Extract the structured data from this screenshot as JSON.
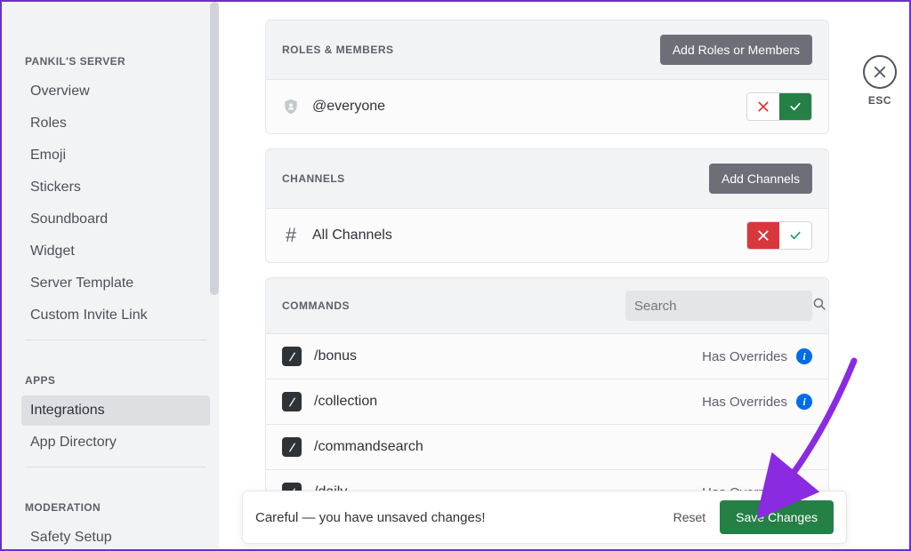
{
  "sidebar": {
    "server_title": "PANKIL'S SERVER",
    "items_main": [
      "Overview",
      "Roles",
      "Emoji",
      "Stickers",
      "Soundboard",
      "Widget",
      "Server Template",
      "Custom Invite Link"
    ],
    "apps_title": "APPS",
    "items_apps": [
      "Integrations",
      "App Directory"
    ],
    "mod_title": "MODERATION",
    "items_mod": [
      "Safety Setup"
    ],
    "active_index_apps": 0
  },
  "esc": {
    "label": "ESC"
  },
  "roles_card": {
    "title": "ROLES & MEMBERS",
    "button": "Add Roles or Members",
    "row_label": "@everyone",
    "selected": "allow"
  },
  "channels_card": {
    "title": "CHANNELS",
    "button": "Add Channels",
    "row_label": "All Channels",
    "selected": "deny"
  },
  "commands_card": {
    "title": "COMMANDS",
    "search_placeholder": "Search",
    "override_label": "Has Overrides",
    "rows": [
      {
        "name": "/bonus",
        "has_overrides": true
      },
      {
        "name": "/collection",
        "has_overrides": true
      },
      {
        "name": "/commandsearch",
        "has_overrides": false
      },
      {
        "name": "/daily",
        "has_overrides": true
      }
    ]
  },
  "unsaved": {
    "text": "Careful — you have unsaved changes!",
    "reset": "Reset",
    "save": "Save Changes"
  },
  "colors": {
    "green": "#248045",
    "red": "#da373c",
    "blue": "#006ce7",
    "purple_arrow": "#8a2be2"
  }
}
